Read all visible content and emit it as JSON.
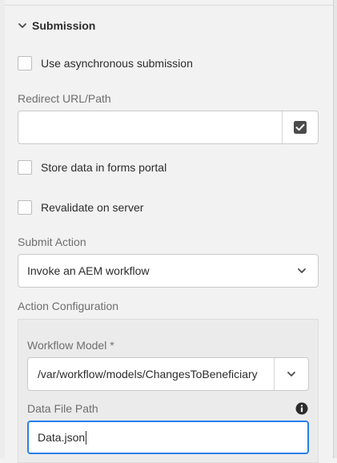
{
  "section": {
    "title": "Submission"
  },
  "async_submission": {
    "label": "Use asynchronous submission",
    "checked": false
  },
  "redirect": {
    "label": "Redirect URL/Path",
    "value": "",
    "browse_icon": "checkmark-square-icon"
  },
  "store_portal": {
    "label": "Store data in forms portal",
    "checked": false
  },
  "revalidate": {
    "label": "Revalidate on server",
    "checked": false
  },
  "submit_action": {
    "label": "Submit Action",
    "selected": "Invoke an AEM workflow"
  },
  "action_config": {
    "label": "Action Configuration",
    "workflow_model": {
      "label": "Workflow Model *",
      "selected": "/var/workflow/models/ChangesToBeneficiary"
    },
    "data_file_path": {
      "label": "Data File Path",
      "value": "Data.json",
      "info_icon": "info-icon"
    }
  },
  "colors": {
    "focus": "#2680eb",
    "background": "#f2f2f2"
  }
}
